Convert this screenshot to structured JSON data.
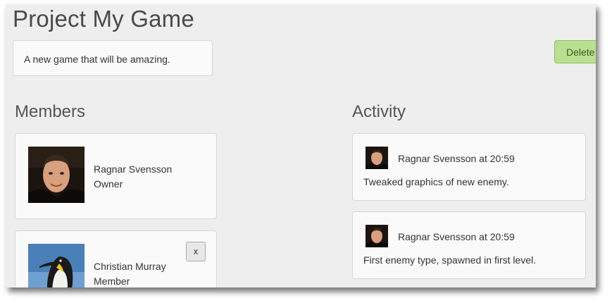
{
  "project": {
    "title": "Project My Game",
    "description": "A new game that will be amazing.",
    "delete_label": "Delete"
  },
  "members": {
    "heading": "Members",
    "items": [
      {
        "name": "Ragnar Svensson",
        "role": "Owner",
        "avatar": "person-photo"
      },
      {
        "name": "Christian Murray",
        "role": "Member",
        "avatar": "penguin-photo",
        "remove_label": "x"
      }
    ]
  },
  "activity": {
    "heading": "Activity",
    "items": [
      {
        "author": "Ragnar Svensson",
        "time": "20:59",
        "header": "Ragnar Svensson at 20:59",
        "text": "Tweaked graphics of new enemy.",
        "avatar": "person-photo"
      },
      {
        "author": "Ragnar Svensson",
        "time": "20:59",
        "header": "Ragnar Svensson at 20:59",
        "text": "First enemy type, spawned in first level.",
        "avatar": "person-photo"
      }
    ]
  },
  "colors": {
    "background": "#eeeeee",
    "card": "#fafafa",
    "delete_button": "#b9e08f"
  }
}
